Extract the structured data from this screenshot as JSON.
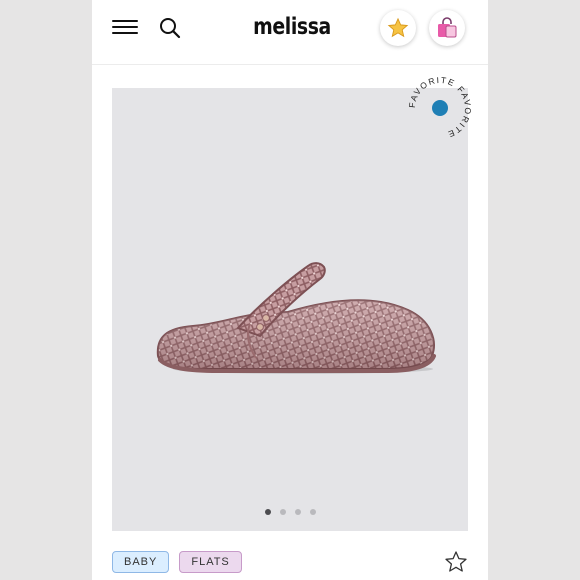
{
  "header": {
    "logo": "melissa",
    "icons": {
      "menu": "hamburger-menu-icon",
      "search": "search-icon",
      "favorites": "star-icon",
      "bag": "shopping-bag-icon"
    }
  },
  "gallery": {
    "product_image": "pink glitter caged flat shoe with strap",
    "badge_text": "FAVORITE FAVORITE",
    "badge_dot_color": "#1f7fb5",
    "image_count": 4,
    "active_index": 0
  },
  "tags": [
    {
      "label": "BABY"
    },
    {
      "label": "FLATS"
    }
  ],
  "colors": {
    "shoe": "#b98a8e",
    "gallery_bg": "#e4e4e7",
    "tag_baby": "#dbeeff",
    "tag_flats": "#ecd9ee"
  }
}
